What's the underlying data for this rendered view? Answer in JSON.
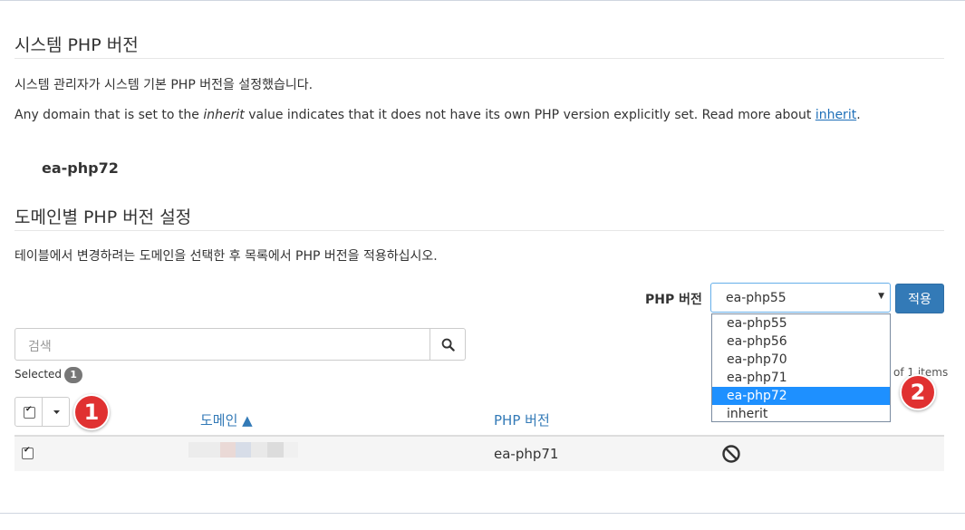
{
  "system": {
    "title": "시스템 PHP 버전",
    "desc": "시스템 관리자가 시스템 기본 PHP 버전을 설정했습니다.",
    "inherit_note": {
      "before": "Any domain that is set to the ",
      "em": "inherit",
      "after": " value indicates that it does not have its own PHP version explicitly set. Read more about ",
      "link": "inherit",
      "end": "."
    },
    "current_version": "ea-php72"
  },
  "domain_settings": {
    "title": "도메인별 PHP 버전 설정",
    "desc": "테이블에서 변경하려는 도메인을 선택한 후 목록에서 PHP 버전을 적용하십시오.",
    "php_version_label": "PHP 버전",
    "select_value": "ea-php55",
    "apply_label": "적용",
    "options": [
      "ea-php55",
      "ea-php56",
      "ea-php70",
      "ea-php71",
      "ea-php72",
      "inherit"
    ],
    "highlighted_option": "ea-php72"
  },
  "search": {
    "placeholder": "검색"
  },
  "selection": {
    "label": "Selected",
    "count": "1"
  },
  "pager": {
    "text": "of 1 items"
  },
  "table": {
    "columns": {
      "domain": "도메인 ▲",
      "php_version": "PHP 버전"
    },
    "rows": [
      {
        "php_version": "ea-php71",
        "status_icon": "ban-icon"
      }
    ]
  },
  "callouts": [
    "1",
    "2"
  ],
  "colors": {
    "accent": "#337ab7",
    "highlight": "#1e90ff",
    "callout": "#e03131"
  }
}
